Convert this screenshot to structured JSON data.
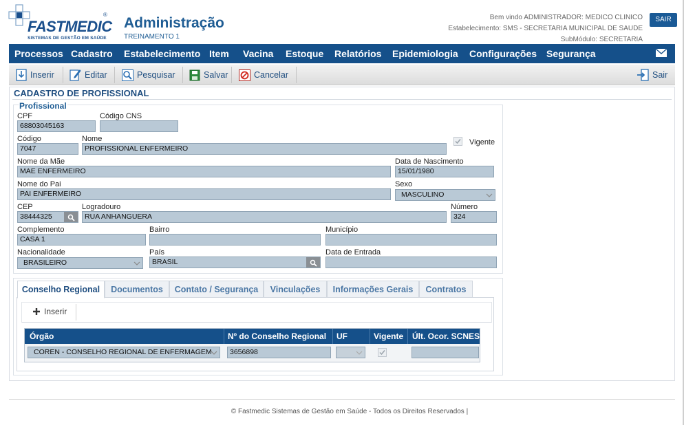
{
  "header": {
    "logo_text": "FASTMEDIC",
    "logo_sub": "SISTEMAS DE GESTÃO EM SAÚDE",
    "logo_reg": "®",
    "title": "Administração",
    "subtitle": "TREINAMENTO 1",
    "welcome": "Bem vindo ADMINISTRADOR: MEDICO CLINICO",
    "establishment": "Estabelecimento: SMS - SECRETARIA MUNICIPAL DE SAUDE",
    "submodule": "SubMódulo: SECRETARIA",
    "logout_label": "SAIR"
  },
  "menu": {
    "items": [
      "Processos",
      "Cadastro",
      "Estabelecimento",
      "Item",
      "Vacina",
      "Estoque",
      "Relatórios",
      "Epidemiologia",
      "Configurações",
      "Segurança"
    ]
  },
  "toolbar": {
    "insert": "Inserir",
    "edit": "Editar",
    "search": "Pesquisar",
    "save": "Salvar",
    "cancel": "Cancelar",
    "exit": "Sair"
  },
  "form": {
    "panel_title": "CADASTRO DE PROFISSIONAL",
    "legend": "Profissional",
    "labels": {
      "cpf": "CPF",
      "cns": "Código CNS",
      "codigo": "Código",
      "nome": "Nome",
      "vigente": "Vigente",
      "nome_mae": "Nome da Mãe",
      "data_nasc": "Data de Nascimento",
      "nome_pai": "Nome do Pai",
      "sexo": "Sexo",
      "cep": "CEP",
      "logradouro": "Logradouro",
      "numero": "Número",
      "complemento": "Complemento",
      "bairro": "Bairro",
      "municipio": "Município",
      "nacionalidade": "Nacionalidade",
      "pais": "País",
      "data_entrada": "Data de Entrada"
    },
    "values": {
      "cpf": "68803045163",
      "cns": "",
      "codigo": "7047",
      "nome": "PROFISSIONAL ENFERMEIRO",
      "nome_mae": "MAE ENFERMEIRO",
      "data_nasc": "15/01/1980",
      "nome_pai": "PAI ENFERMEIRO",
      "sexo": "MASCULINO",
      "cep": "38444325",
      "logradouro": "RUA ANHANGUERA",
      "numero": "324",
      "complemento": "CASA 1",
      "bairro": "",
      "municipio": "",
      "nacionalidade": "BRASILEIRO",
      "pais": "BRASIL",
      "data_entrada": ""
    },
    "vigente_checked": true
  },
  "tabs": {
    "items": [
      "Conselho Regional",
      "Documentos",
      "Contato / Segurança",
      "Vinculações",
      "Informações Gerais",
      "Contratos"
    ],
    "active_index": 0,
    "insert_label": "Inserir"
  },
  "grid": {
    "columns": [
      "Órgão",
      "Nº do Conselho Regional",
      "UF",
      "Vigente",
      "Últ. Ocor. SCNES"
    ],
    "rows": [
      {
        "orgao": "COREN - CONSELHO REGIONAL DE ENFERMAGEM",
        "numero": "3656898",
        "uf": "",
        "vigente": true,
        "ultima": ""
      }
    ]
  },
  "footer": {
    "text": "© Fastmedic Sistemas de Gestão em Saúde - Todos os Direitos Reservados |"
  },
  "colors": {
    "brand": "#15508a",
    "field_bg": "#b9c9d6",
    "title": "#1f5d94"
  }
}
